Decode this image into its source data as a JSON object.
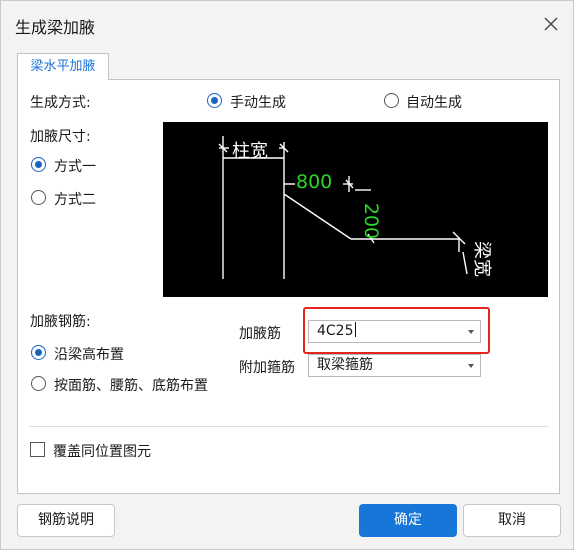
{
  "window": {
    "title": "生成梁加腋"
  },
  "tabs": [
    {
      "label": "梁水平加腋"
    }
  ],
  "generation": {
    "label": "生成方式:",
    "options": [
      {
        "label": "手动生成",
        "selected": true
      },
      {
        "label": "自动生成",
        "selected": false
      }
    ]
  },
  "size": {
    "label": "加腋尺寸:",
    "options": [
      {
        "label": "方式一",
        "selected": true
      },
      {
        "label": "方式二",
        "selected": false
      }
    ]
  },
  "diagram": {
    "column_width_label": "柱宽",
    "length_label": "800",
    "width_label": "200",
    "beam_width_label": "梁宽",
    "colors": {
      "background": "#000000",
      "lines": "#ffffff",
      "dimensions": "#2bd52b"
    }
  },
  "rebar": {
    "label": "加腋钢筋:",
    "options": [
      {
        "label": "沿梁高布置",
        "selected": true
      },
      {
        "label": "按面筋、腰筋、底筋布置",
        "selected": false
      }
    ],
    "haunch_rebar": {
      "label": "加腋筋",
      "value": "4C25"
    },
    "stirrup": {
      "label": "附加箍筋",
      "value": "取梁箍筋"
    }
  },
  "overwrite": {
    "label": "覆盖同位置图元",
    "checked": false
  },
  "buttons": {
    "help": "钢筋说明",
    "ok": "确定",
    "cancel": "取消"
  },
  "colors": {
    "accent": "#1677d9",
    "highlight": "#e52420"
  }
}
